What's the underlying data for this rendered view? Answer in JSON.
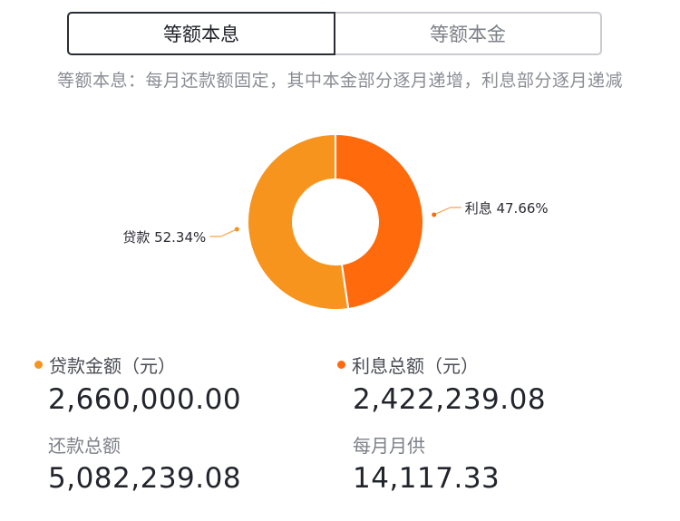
{
  "tabs": [
    {
      "label": "等额本息",
      "active": true
    },
    {
      "label": "等额本金",
      "active": false
    }
  ],
  "description": "等额本息：每月还款额固定，其中本金部分逐月递增，利息部分逐月递减",
  "colors": {
    "loan": "#F7941D",
    "interest": "#FF6A0D",
    "label_line": "#F7A54A"
  },
  "chart_data": {
    "type": "pie",
    "style": "donut",
    "slices": [
      {
        "name": "贷款",
        "value": 52.34,
        "label": "贷款 52.34%",
        "color": "#F7941D"
      },
      {
        "name": "利息",
        "value": 47.66,
        "label": "利息 47.66%",
        "color": "#FF6A0D"
      }
    ]
  },
  "summary": {
    "loan_amount": {
      "label": "贷款金额（元）",
      "value": "2,660,000.00"
    },
    "interest_total": {
      "label": "利息总额（元）",
      "value": "2,422,239.08"
    },
    "repayment_total": {
      "label": "还款总额",
      "value": "5,082,239.08"
    },
    "monthly_payment": {
      "label": "每月月供",
      "value": "14,117.33"
    }
  }
}
